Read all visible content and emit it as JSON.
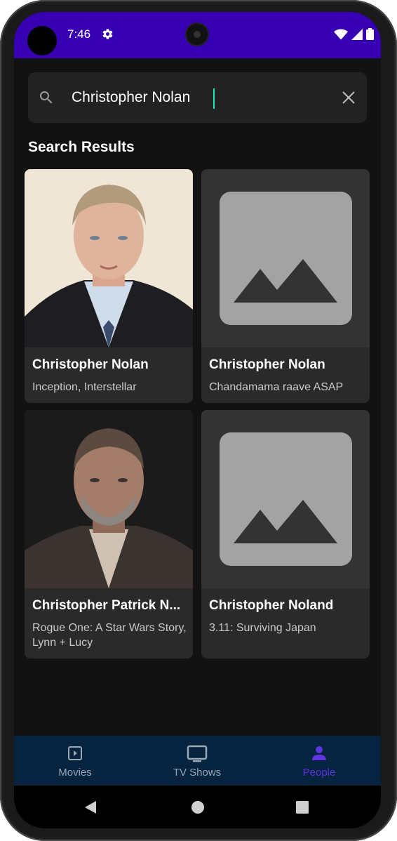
{
  "status_bar": {
    "time": "7:46"
  },
  "search": {
    "query": "Christopher Nolan"
  },
  "results": {
    "title": "Search Results",
    "items": [
      {
        "name": "Christopher Nolan",
        "works": "Inception, Interstellar"
      },
      {
        "name": "Christopher Nolan",
        "works": "Chandamama raave ASAP"
      },
      {
        "name": "Christopher Patrick N...",
        "works": "Rogue One: A Star Wars Story, Lynn + Lucy"
      },
      {
        "name": "Christopher Noland",
        "works": "3.11: Surviving Japan"
      }
    ]
  },
  "bottom_nav": {
    "items": [
      {
        "label": "Movies",
        "icon": "movie-icon"
      },
      {
        "label": "TV Shows",
        "icon": "tv-icon"
      },
      {
        "label": "People",
        "icon": "person-icon"
      }
    ],
    "active_index": 2
  },
  "colors": {
    "status_bar": "#3700b3",
    "accent": "#5e35e0",
    "caret": "#1de9b6",
    "background": "#121212",
    "nav_background": "#06233f"
  }
}
